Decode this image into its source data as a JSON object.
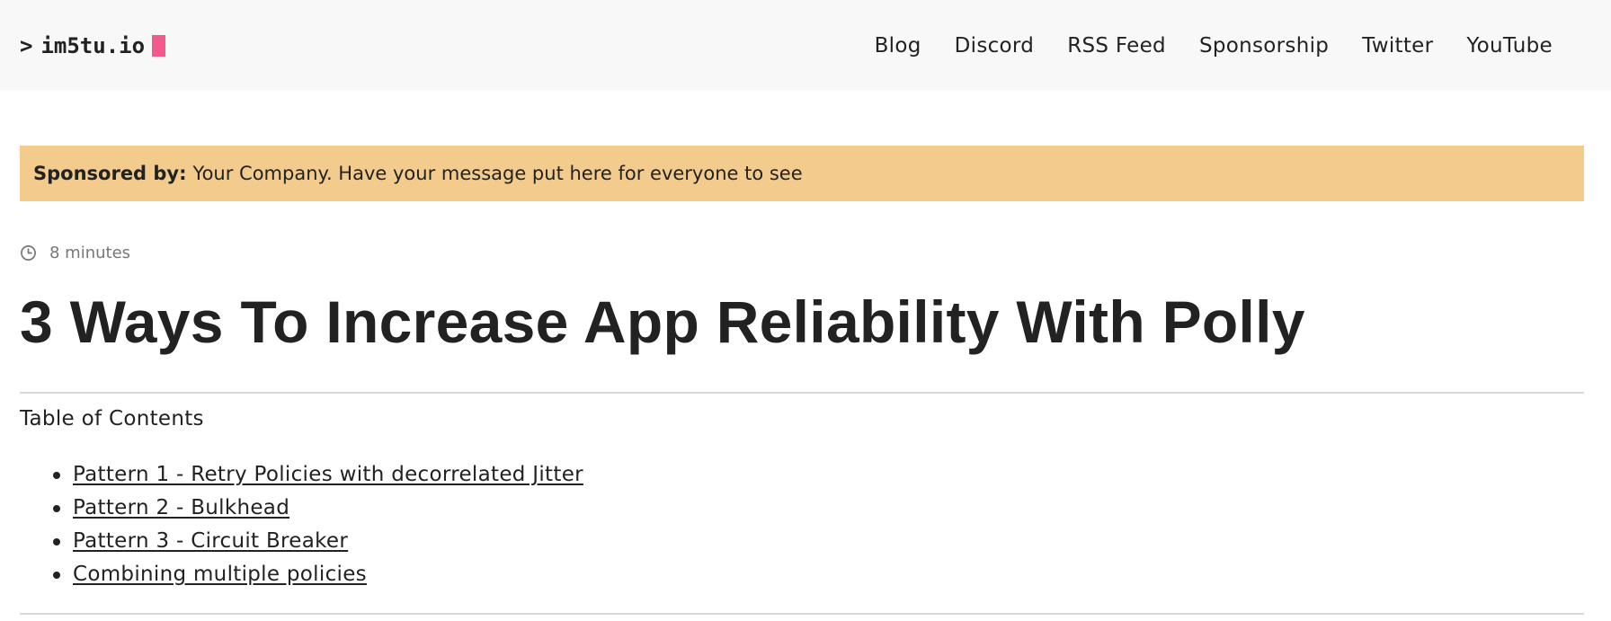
{
  "header": {
    "logo_prompt": ">",
    "logo_text": "im5tu.io",
    "nav": [
      "Blog",
      "Discord",
      "RSS Feed",
      "Sponsorship",
      "Twitter",
      "YouTube"
    ]
  },
  "sponsor": {
    "label": "Sponsored by:",
    "text": "Your Company. Have your message put here for everyone to see"
  },
  "article": {
    "reading_time": "8 minutes",
    "title": "3 Ways To Increase App Reliability With Polly",
    "toc_heading": "Table of Contents",
    "toc_items": [
      "Pattern 1 - Retry Policies with decorrelated Jitter",
      "Pattern 2 - Bulkhead",
      "Pattern 3 - Circuit Breaker",
      "Combining multiple policies"
    ]
  },
  "colors": {
    "header_bg": "#f8f8f8",
    "cursor_accent": "#f25a8e",
    "sponsor_bg": "#f2cb8d",
    "text": "#222222"
  },
  "icons": {
    "reading_time": "clock-icon"
  }
}
